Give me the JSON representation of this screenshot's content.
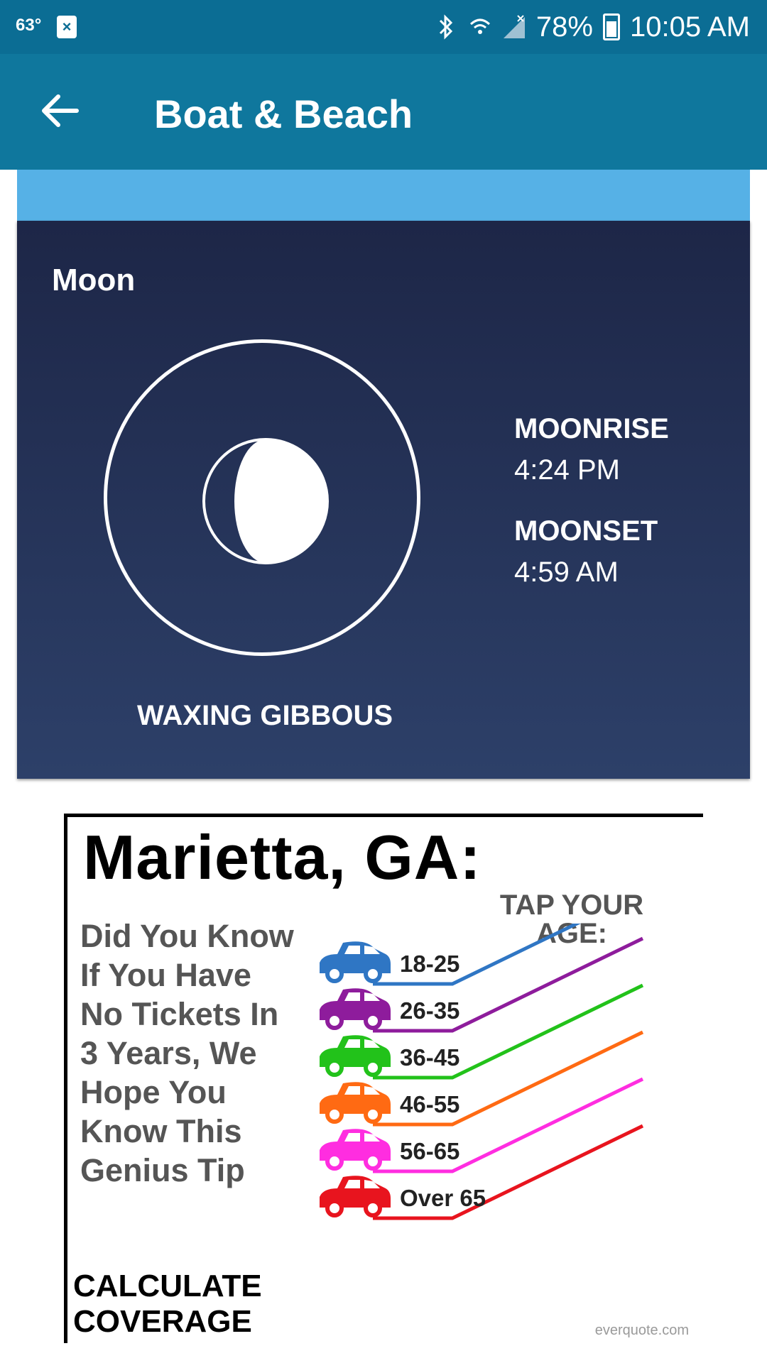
{
  "status_bar": {
    "temperature": "63°",
    "notification_icon": "x-box-icon",
    "battery": "78%",
    "time": "10:05 AM",
    "icons": [
      "bluetooth-icon",
      "wifi-icon",
      "signal-icon",
      "battery-charging-icon"
    ]
  },
  "app_bar": {
    "title": "Boat & Beach",
    "back_icon": "arrow-left-icon"
  },
  "moon": {
    "section_title": "Moon",
    "phase": "WAXING GIBBOUS",
    "moonrise_label": "MOONRISE",
    "moonrise_time": "4:24 PM",
    "moonset_label": "MOONSET",
    "moonset_time": "4:59 AM"
  },
  "ad": {
    "headline": "Marietta, GA:",
    "body_lines": [
      "Did You Know",
      "If You Have",
      "No Tickets In",
      "3 Years, We",
      "Hope You",
      "Know This",
      "Genius Tip"
    ],
    "cta_lines": [
      "CALCULATE",
      "COVERAGE"
    ],
    "tap_lines": [
      "TAP YOUR",
      "AGE:"
    ],
    "age_groups": [
      {
        "label": "18-25",
        "color": "#2f76c4"
      },
      {
        "label": "26-35",
        "color": "#8e1c9c"
      },
      {
        "label": "36-45",
        "color": "#22c21a"
      },
      {
        "label": "46-55",
        "color": "#ff6a13"
      },
      {
        "label": "56-65",
        "color": "#ff2de0"
      },
      {
        "label": "Over 65",
        "color": "#e8141e"
      }
    ],
    "footer": "everquote.com"
  },
  "colors": {
    "status_bar": "#0b6d94",
    "app_bar": "#0f779d",
    "strip": "#56b1e6",
    "card_top": "#1d2647",
    "card_bottom": "#2d4069"
  }
}
